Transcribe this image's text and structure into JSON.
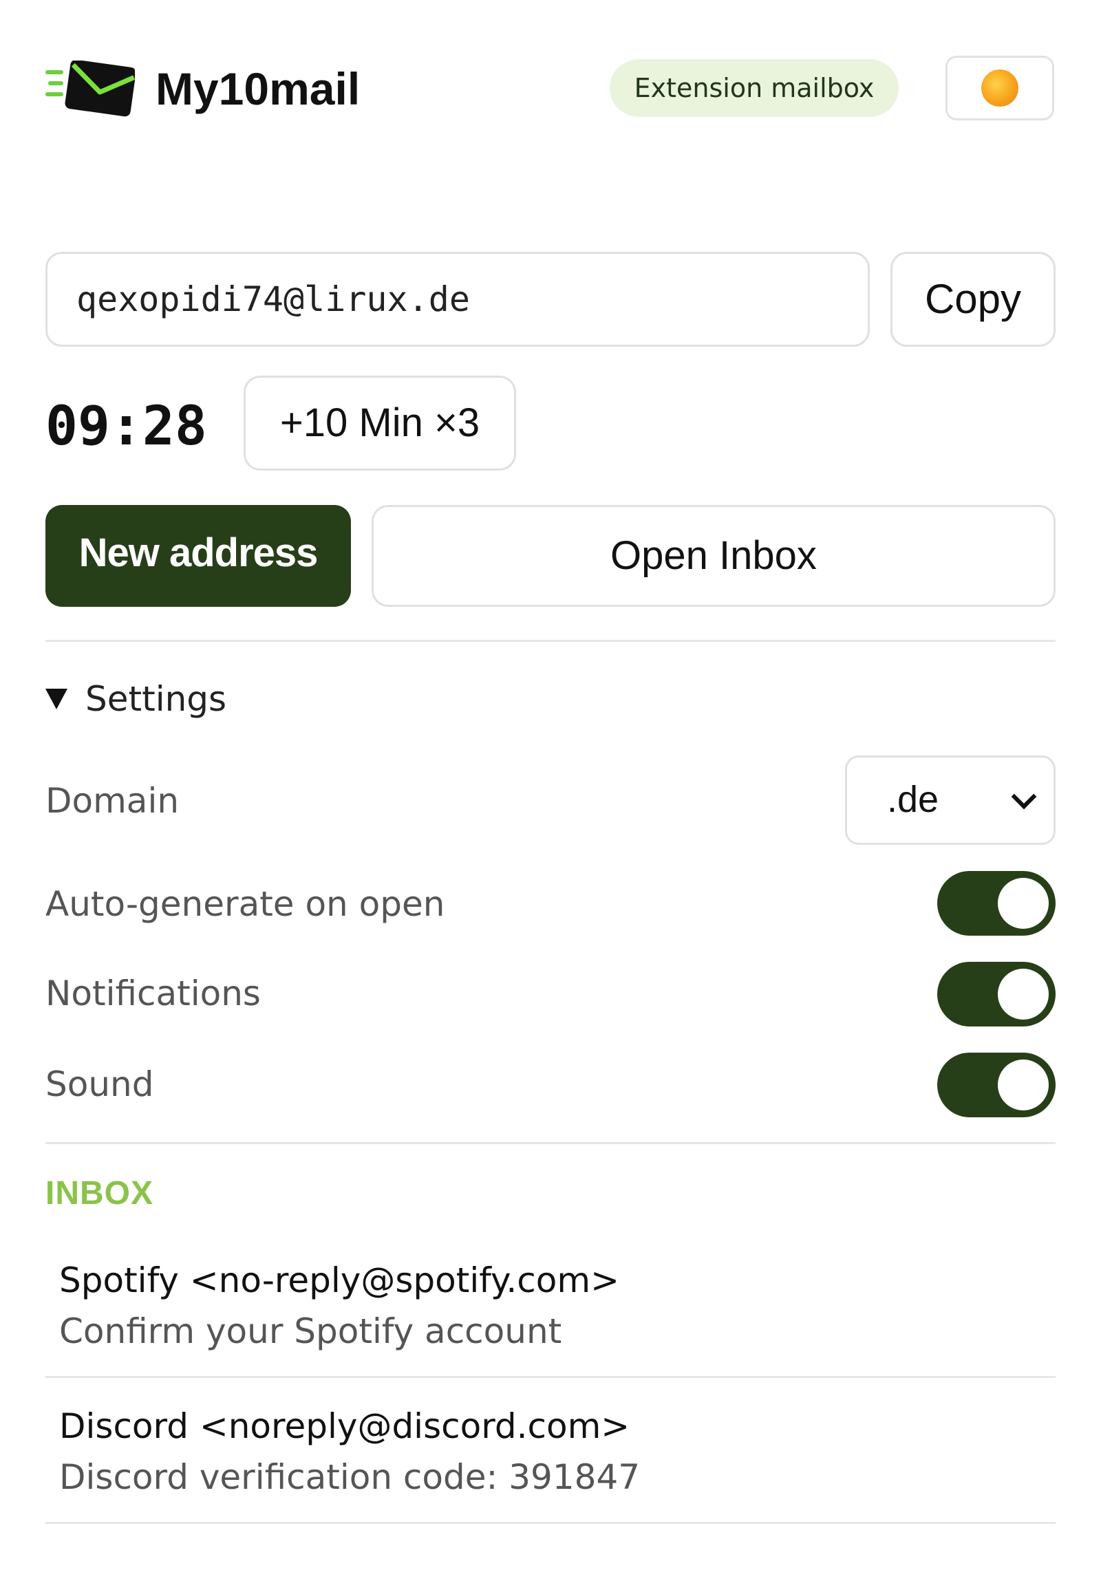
{
  "header": {
    "brand": "My10mail",
    "badge": "Extension mailbox",
    "logo_icon": "envelope-icon",
    "theme_icon": "sun-icon"
  },
  "address": {
    "value": "qexopidi74@lirux.de",
    "copy_label": "Copy"
  },
  "timer": {
    "remaining": "09:28",
    "extend_label": "+10 Min ×3"
  },
  "actions": {
    "new_address_label": "New address",
    "open_inbox_label": "Open Inbox"
  },
  "settings": {
    "summary": "Settings",
    "domain_label": "Domain",
    "domain_value": ".de",
    "auto_generate_label": "Auto-generate on open",
    "auto_generate_on": true,
    "notifications_label": "Notifications",
    "notifications_on": true,
    "sound_label": "Sound",
    "sound_on": true
  },
  "inbox": {
    "title": "INBOX",
    "messages": [
      {
        "from": "Spotify <no-reply@spotify.com>",
        "subject": "Confirm your Spotify account"
      },
      {
        "from": "Discord <noreply@discord.com>",
        "subject": "Discord verification code: 391847"
      }
    ]
  },
  "colors": {
    "accent": "#263f18",
    "inbox_heading": "#8bc34a",
    "badge_bg": "#eaf4dc"
  }
}
